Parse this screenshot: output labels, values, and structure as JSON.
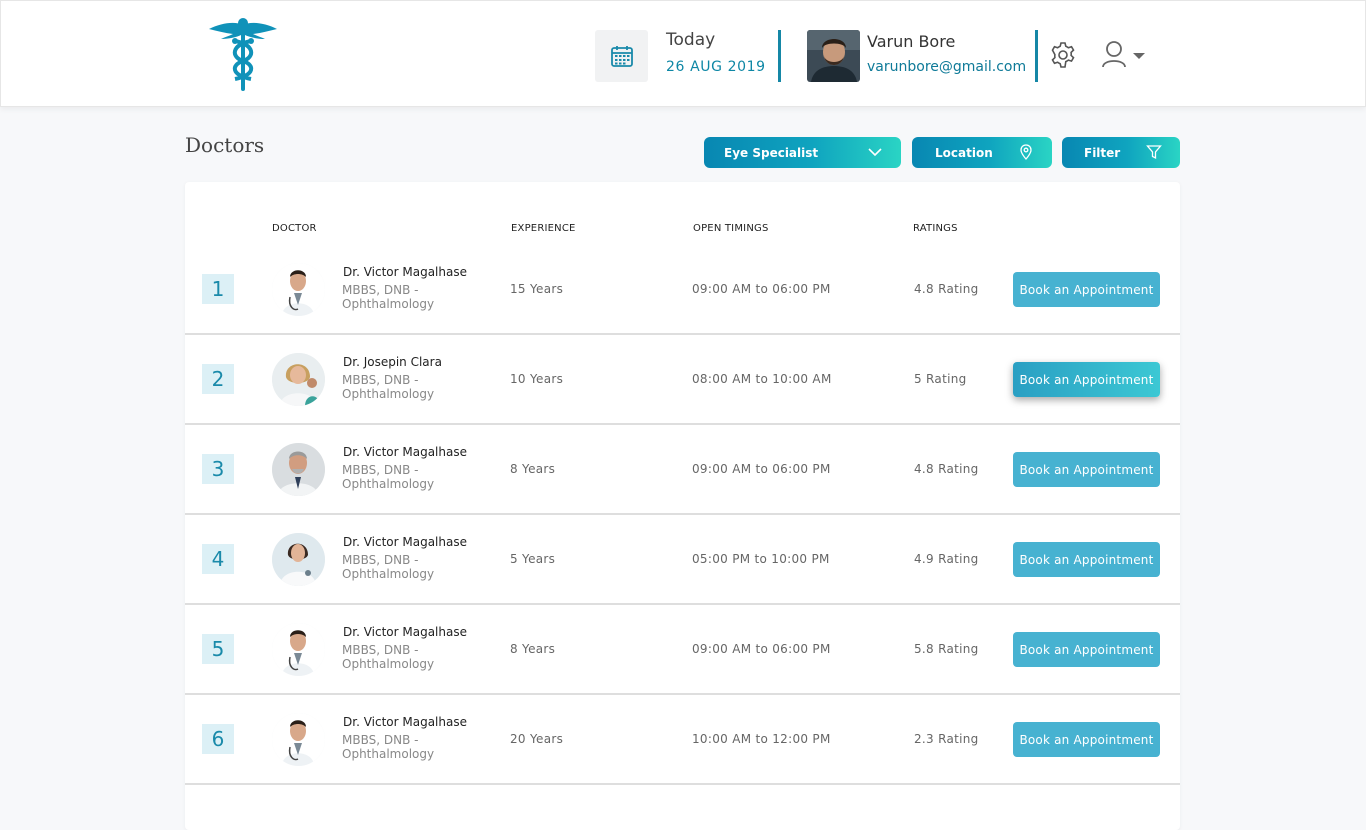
{
  "header": {
    "date_label": "Today",
    "date_value": "26 AUG 2019",
    "user_name": "Varun Bore",
    "user_email": "varunbore@gmail.com",
    "icons": [
      "caduceus-logo",
      "calendar-icon",
      "gear-icon",
      "user-icon",
      "chevron-down-icon"
    ]
  },
  "page": {
    "title": "Doctors"
  },
  "filters": {
    "specialty": "Eye Specialist",
    "location": "Location",
    "filter": "Filter"
  },
  "table": {
    "columns": [
      "DOCTOR",
      "EXPERIENCE",
      "OPEN TIMINGS",
      "RATINGS"
    ],
    "book_label": "Book an Appointment",
    "rows": [
      {
        "num": "1",
        "name": "Dr. Victor Magalhase",
        "qual1": "MBBS, DNB -",
        "qual2": "Ophthalmology",
        "experience": "15 Years",
        "timings": "09:00 AM to 06:00 PM",
        "rating": "4.8 Rating"
      },
      {
        "num": "2",
        "name": "Dr. Josepin Clara",
        "qual1": "MBBS, DNB -",
        "qual2": "Ophthalmology",
        "experience": "10 Years",
        "timings": "08:00 AM to 10:00 AM",
        "rating": "5 Rating"
      },
      {
        "num": "3",
        "name": "Dr. Victor Magalhase",
        "qual1": "MBBS, DNB -",
        "qual2": "Ophthalmology",
        "experience": "8 Years",
        "timings": "09:00 AM to 06:00 PM",
        "rating": "4.8 Rating"
      },
      {
        "num": "4",
        "name": "Dr. Victor Magalhase",
        "qual1": "MBBS, DNB -",
        "qual2": "Ophthalmology",
        "experience": "5 Years",
        "timings": "05:00 PM to 10:00 PM",
        "rating": "4.9 Rating"
      },
      {
        "num": "5",
        "name": "Dr. Victor Magalhase",
        "qual1": "MBBS, DNB -",
        "qual2": "Ophthalmology",
        "experience": "8 Years",
        "timings": "09:00 AM to 06:00 PM",
        "rating": "5.8 Rating"
      },
      {
        "num": "6",
        "name": "Dr. Victor Magalhase",
        "qual1": "MBBS, DNB -",
        "qual2": "Ophthalmology",
        "experience": "20 Years",
        "timings": "10:00 AM to 12:00 PM",
        "rating": "2.3 Rating"
      }
    ]
  },
  "colors": {
    "accent": "#0e87a5",
    "button": "#47b2d1",
    "number_bg": "#dcf0f6"
  }
}
